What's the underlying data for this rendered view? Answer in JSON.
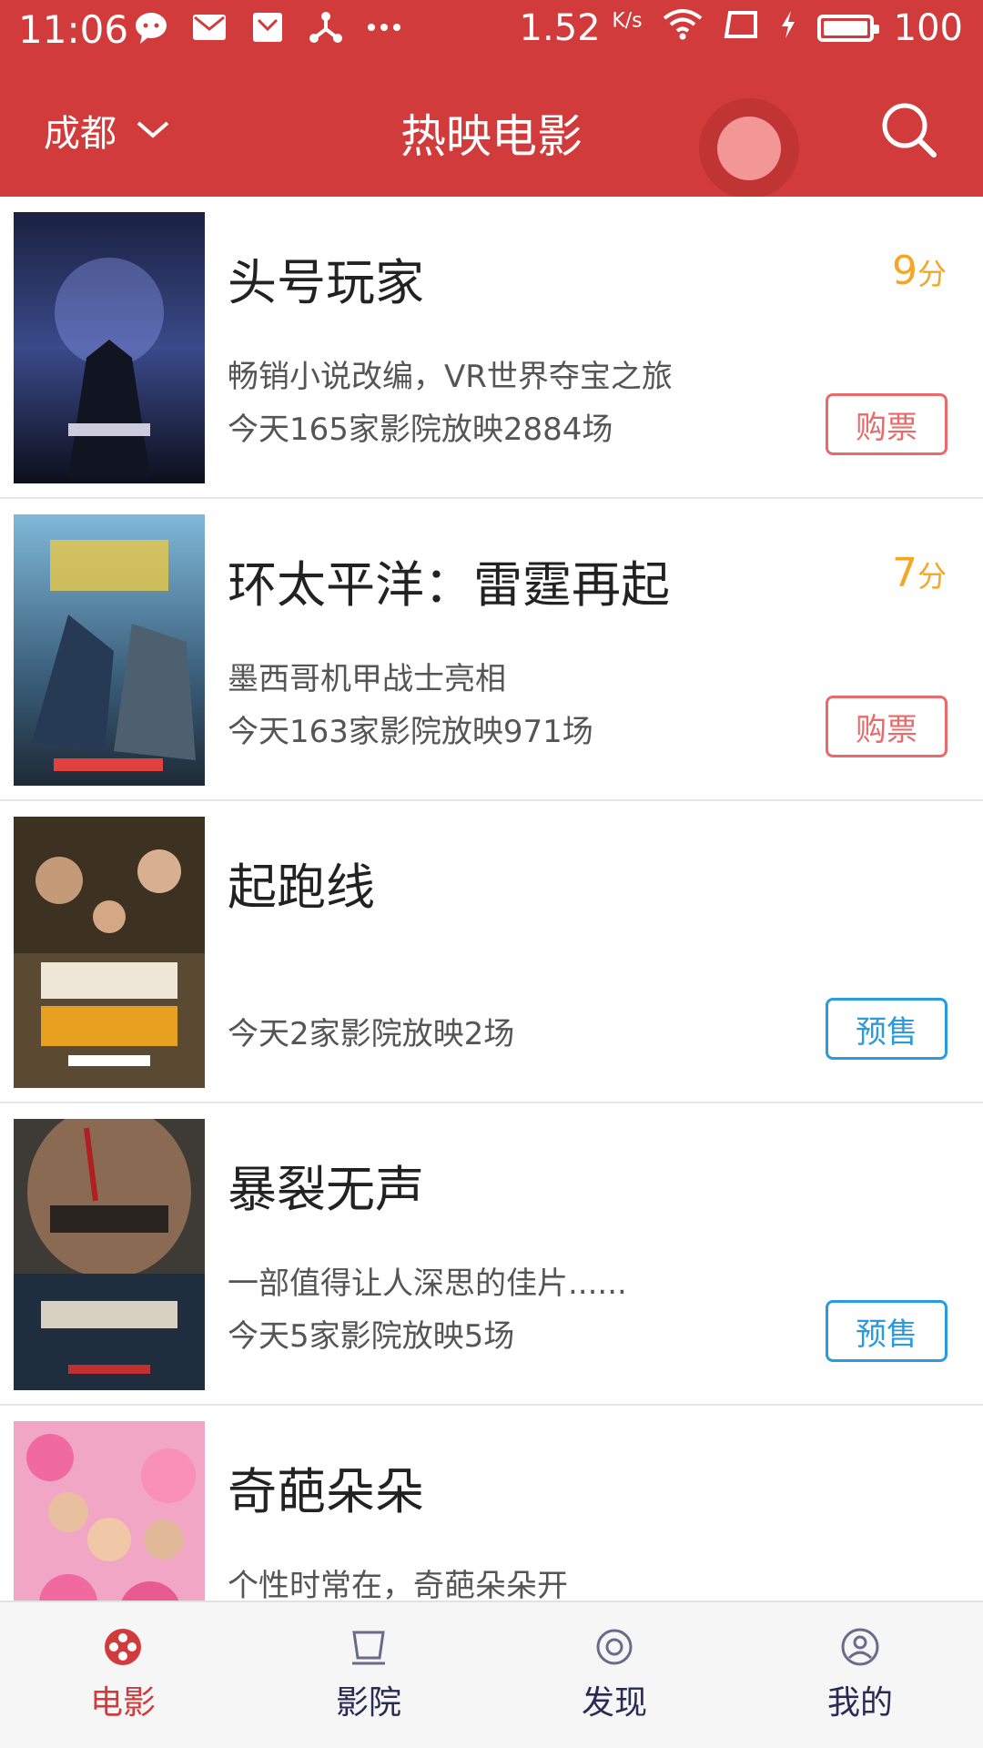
{
  "status_bar": {
    "time": "11:06",
    "network_speed": "1.52",
    "network_unit": "K/s",
    "battery": "100",
    "icons": [
      "chat-icon",
      "mail-icon",
      "inbox-icon",
      "share-icon",
      "more-icon",
      "wifi-icon",
      "screen-icon",
      "charging-icon",
      "battery-icon"
    ]
  },
  "header": {
    "city": "成都",
    "title": "热映电影"
  },
  "movies": [
    {
      "name": "头号玩家",
      "score": "9",
      "score_unit": "分",
      "desc": "畅销小说改编，VR世界夺宝之旅",
      "info": "今天165家影院放映2884场",
      "button": "购票"
    },
    {
      "name": "环太平洋：雷霆再起",
      "score": "7",
      "score_unit": "分",
      "desc": "墨西哥机甲战士亮相",
      "info": "今天163家影院放映971场",
      "button": "购票"
    },
    {
      "name": "起跑线",
      "score": "",
      "score_unit": "",
      "desc": "",
      "info": "今天2家影院放映2场",
      "button": "预售"
    },
    {
      "name": "暴裂无声",
      "score": "",
      "score_unit": "",
      "desc": "一部值得让人深思的佳片......",
      "info": "今天5家影院放映5场",
      "button": "预售"
    },
    {
      "name": "奇葩朵朵",
      "score": "",
      "score_unit": "",
      "desc": "个性时常在，奇葩朵朵开",
      "info": "",
      "button": ""
    }
  ],
  "bottom_nav": {
    "items": [
      {
        "label": "电影",
        "icon": "film-reel-icon",
        "active": true
      },
      {
        "label": "影院",
        "icon": "cinema-screen-icon",
        "active": false
      },
      {
        "label": "发现",
        "icon": "discover-icon",
        "active": false
      },
      {
        "label": "我的",
        "icon": "profile-icon",
        "active": false
      }
    ]
  },
  "colors": {
    "brand_red": "#D23B3B",
    "score_orange": "#F5A623",
    "buy_red": "#E96A6A",
    "presale_blue": "#2A9BDD"
  }
}
